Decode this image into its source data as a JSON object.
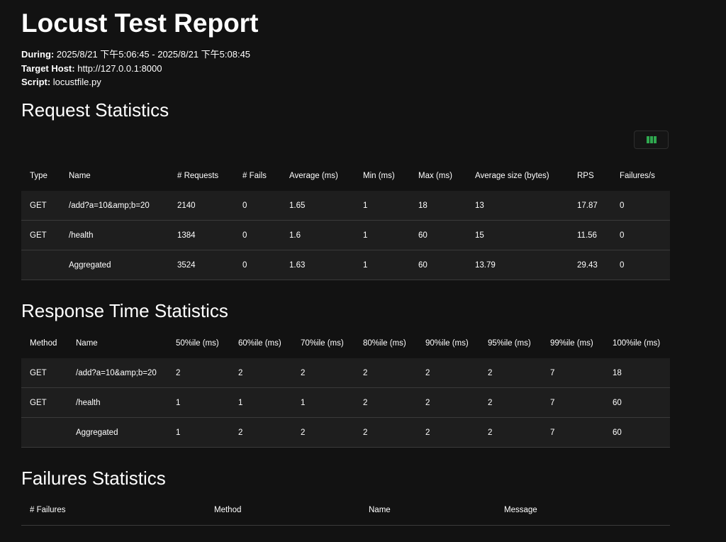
{
  "report": {
    "title": "Locust Test Report",
    "during_label": "During:",
    "during_value": "2025/8/21 下午5:06:45 - 2025/8/21 下午5:08:45",
    "target_label": "Target Host:",
    "target_value": "http://127.0.0.1:8000",
    "script_label": "Script:",
    "script_value": "locustfile.py"
  },
  "request_stats": {
    "heading": "Request Statistics",
    "toggle_icon": "columns-icon",
    "accent": "#2fa84f",
    "headers": [
      "Type",
      "Name",
      "# Requests",
      "# Fails",
      "Average (ms)",
      "Min (ms)",
      "Max (ms)",
      "Average size (bytes)",
      "RPS",
      "Failures/s"
    ],
    "rows": [
      [
        "GET",
        "/add?a=10&amp;b=20",
        "2140",
        "0",
        "1.65",
        "1",
        "18",
        "13",
        "17.87",
        "0"
      ],
      [
        "GET",
        "/health",
        "1384",
        "0",
        "1.6",
        "1",
        "60",
        "15",
        "11.56",
        "0"
      ],
      [
        "",
        "Aggregated",
        "3524",
        "0",
        "1.63",
        "1",
        "60",
        "13.79",
        "29.43",
        "0"
      ]
    ]
  },
  "response_stats": {
    "heading": "Response Time Statistics",
    "headers": [
      "Method",
      "Name",
      "50%ile (ms)",
      "60%ile (ms)",
      "70%ile (ms)",
      "80%ile (ms)",
      "90%ile (ms)",
      "95%ile (ms)",
      "99%ile (ms)",
      "100%ile (ms)"
    ],
    "rows": [
      [
        "GET",
        "/add?a=10&amp;b=20",
        "2",
        "2",
        "2",
        "2",
        "2",
        "2",
        "7",
        "18"
      ],
      [
        "GET",
        "/health",
        "1",
        "1",
        "1",
        "2",
        "2",
        "2",
        "7",
        "60"
      ],
      [
        "",
        "Aggregated",
        "1",
        "2",
        "2",
        "2",
        "2",
        "2",
        "7",
        "60"
      ]
    ]
  },
  "failure_stats": {
    "heading": "Failures Statistics",
    "headers": [
      "# Failures",
      "Method",
      "Name",
      "Message"
    ],
    "rows": []
  }
}
